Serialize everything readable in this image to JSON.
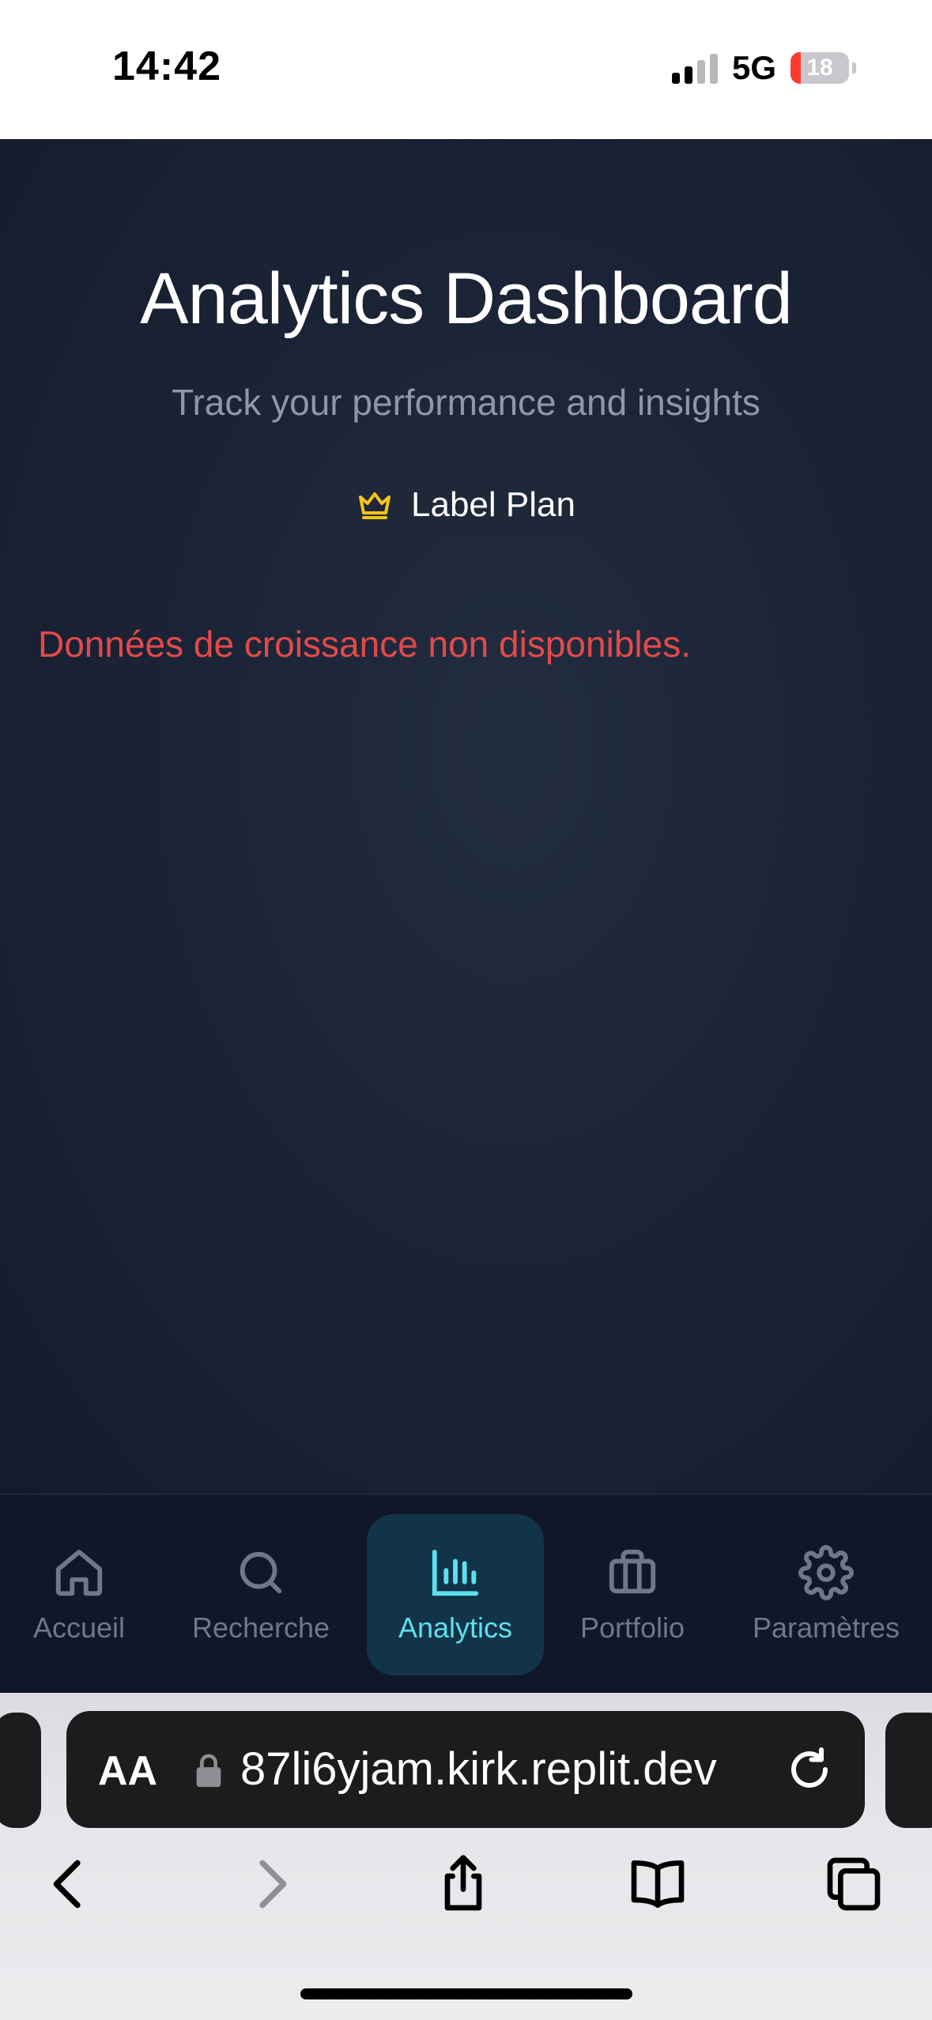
{
  "status_bar": {
    "time": "14:42",
    "network": "5G",
    "battery": "18",
    "battery_level_percent": 18
  },
  "app": {
    "title": "Analytics Dashboard",
    "subtitle": "Track your performance and insights",
    "plan_badge": {
      "icon": "crown-icon",
      "label": "Label Plan",
      "icon_color": "#f5c518"
    },
    "error_message": "Données de croissance non disponibles.",
    "error_color": "#e24a4a"
  },
  "bottom_nav": {
    "items": [
      {
        "label": "Accueil",
        "icon": "home-icon"
      },
      {
        "label": "Recherche",
        "icon": "search-icon"
      },
      {
        "label": "Analytics",
        "icon": "bar-chart-icon",
        "active": true
      },
      {
        "label": "Portfolio",
        "icon": "briefcase-icon"
      },
      {
        "label": "Paramètres",
        "icon": "gear-icon"
      }
    ],
    "active_color": "#5ee0ee"
  },
  "browser": {
    "text_size_label": "AA",
    "url": "87li6yjam.kirk.replit.dev"
  }
}
